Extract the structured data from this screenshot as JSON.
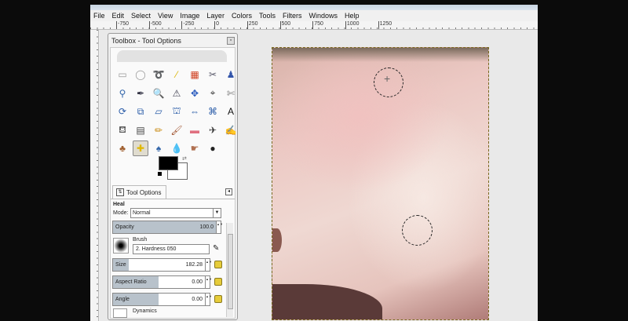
{
  "menu": [
    "File",
    "Edit",
    "Select",
    "View",
    "Image",
    "Layer",
    "Colors",
    "Tools",
    "Filters",
    "Windows",
    "Help"
  ],
  "ruler_ticks": [
    "-750",
    "-500",
    "-250",
    "0",
    "250",
    "500",
    "750",
    "1000",
    "1250"
  ],
  "toolbox": {
    "title": "Toolbox - Tool Options",
    "tools": [
      {
        "n": "rect-select",
        "g": "▭",
        "c": "#999"
      },
      {
        "n": "ellipse-select",
        "g": "◯",
        "c": "#999"
      },
      {
        "n": "free-select",
        "g": "➰",
        "c": "#888"
      },
      {
        "n": "fuzzy-select",
        "g": "⁄",
        "c": "#d9b400"
      },
      {
        "n": "color-select",
        "g": "▦",
        "c": "#d04020"
      },
      {
        "n": "scissors",
        "g": "✂",
        "c": "#556"
      },
      {
        "n": "foreground-select",
        "g": "♟",
        "c": "#3355aa"
      },
      {
        "n": "paths",
        "g": "⚲",
        "c": "#3366aa"
      },
      {
        "n": "color-picker",
        "g": "✒",
        "c": "#334"
      },
      {
        "n": "zoom",
        "g": "🔍",
        "c": "#557"
      },
      {
        "n": "measure",
        "g": "⚠",
        "c": "#445"
      },
      {
        "n": "move",
        "g": "✥",
        "c": "#2255bb"
      },
      {
        "n": "align",
        "g": "⌖",
        "c": "#333"
      },
      {
        "n": "crop",
        "g": "✄",
        "c": "#777"
      },
      {
        "n": "rotate",
        "g": "⟳",
        "c": "#2a5ca8"
      },
      {
        "n": "scale",
        "g": "⧉",
        "c": "#2a5ca8"
      },
      {
        "n": "shear",
        "g": "▱",
        "c": "#2a5ca8"
      },
      {
        "n": "perspective",
        "g": "⛫",
        "c": "#2a5ca8"
      },
      {
        "n": "flip",
        "g": "⇔",
        "c": "#2a5ca8"
      },
      {
        "n": "cage",
        "g": "⌘",
        "c": "#2a5ca8"
      },
      {
        "n": "text",
        "g": "A",
        "c": "#111"
      },
      {
        "n": "bucket-fill",
        "g": "⛾",
        "c": "#555"
      },
      {
        "n": "blend",
        "g": "▤",
        "c": "#444"
      },
      {
        "n": "pencil",
        "g": "✏",
        "c": "#c88a10"
      },
      {
        "n": "paintbrush",
        "g": "🖌",
        "c": "#a0522d"
      },
      {
        "n": "eraser",
        "g": "▬",
        "c": "#e07080"
      },
      {
        "n": "airbrush",
        "g": "✈",
        "c": "#333"
      },
      {
        "n": "ink",
        "g": "✍",
        "c": "#335"
      },
      {
        "n": "clone",
        "g": "♣",
        "c": "#a06030"
      },
      {
        "n": "heal",
        "g": "✚",
        "c": "#e0b800"
      },
      {
        "n": "perspective-clone",
        "g": "♠",
        "c": "#3366aa"
      },
      {
        "n": "blur",
        "g": "💧",
        "c": "#4488cc"
      },
      {
        "n": "smudge",
        "g": "☛",
        "c": "#b07050"
      },
      {
        "n": "dodge-burn",
        "g": "●",
        "c": "#222"
      }
    ],
    "tab_label": "Tool Options",
    "tool_name": "Heal",
    "mode_label": "Mode:",
    "mode_value": "Normal",
    "opacity_label": "Opacity",
    "opacity_value": "100.0",
    "brush_label": "Brush",
    "brush_value": "2. Hardness 050",
    "size_label": "Size",
    "size_value": "182.28",
    "aspect_label": "Aspect Ratio",
    "aspect_value": "0.00",
    "angle_label": "Angle",
    "angle_value": "0.00",
    "dynamics_label": "Dynamics"
  }
}
